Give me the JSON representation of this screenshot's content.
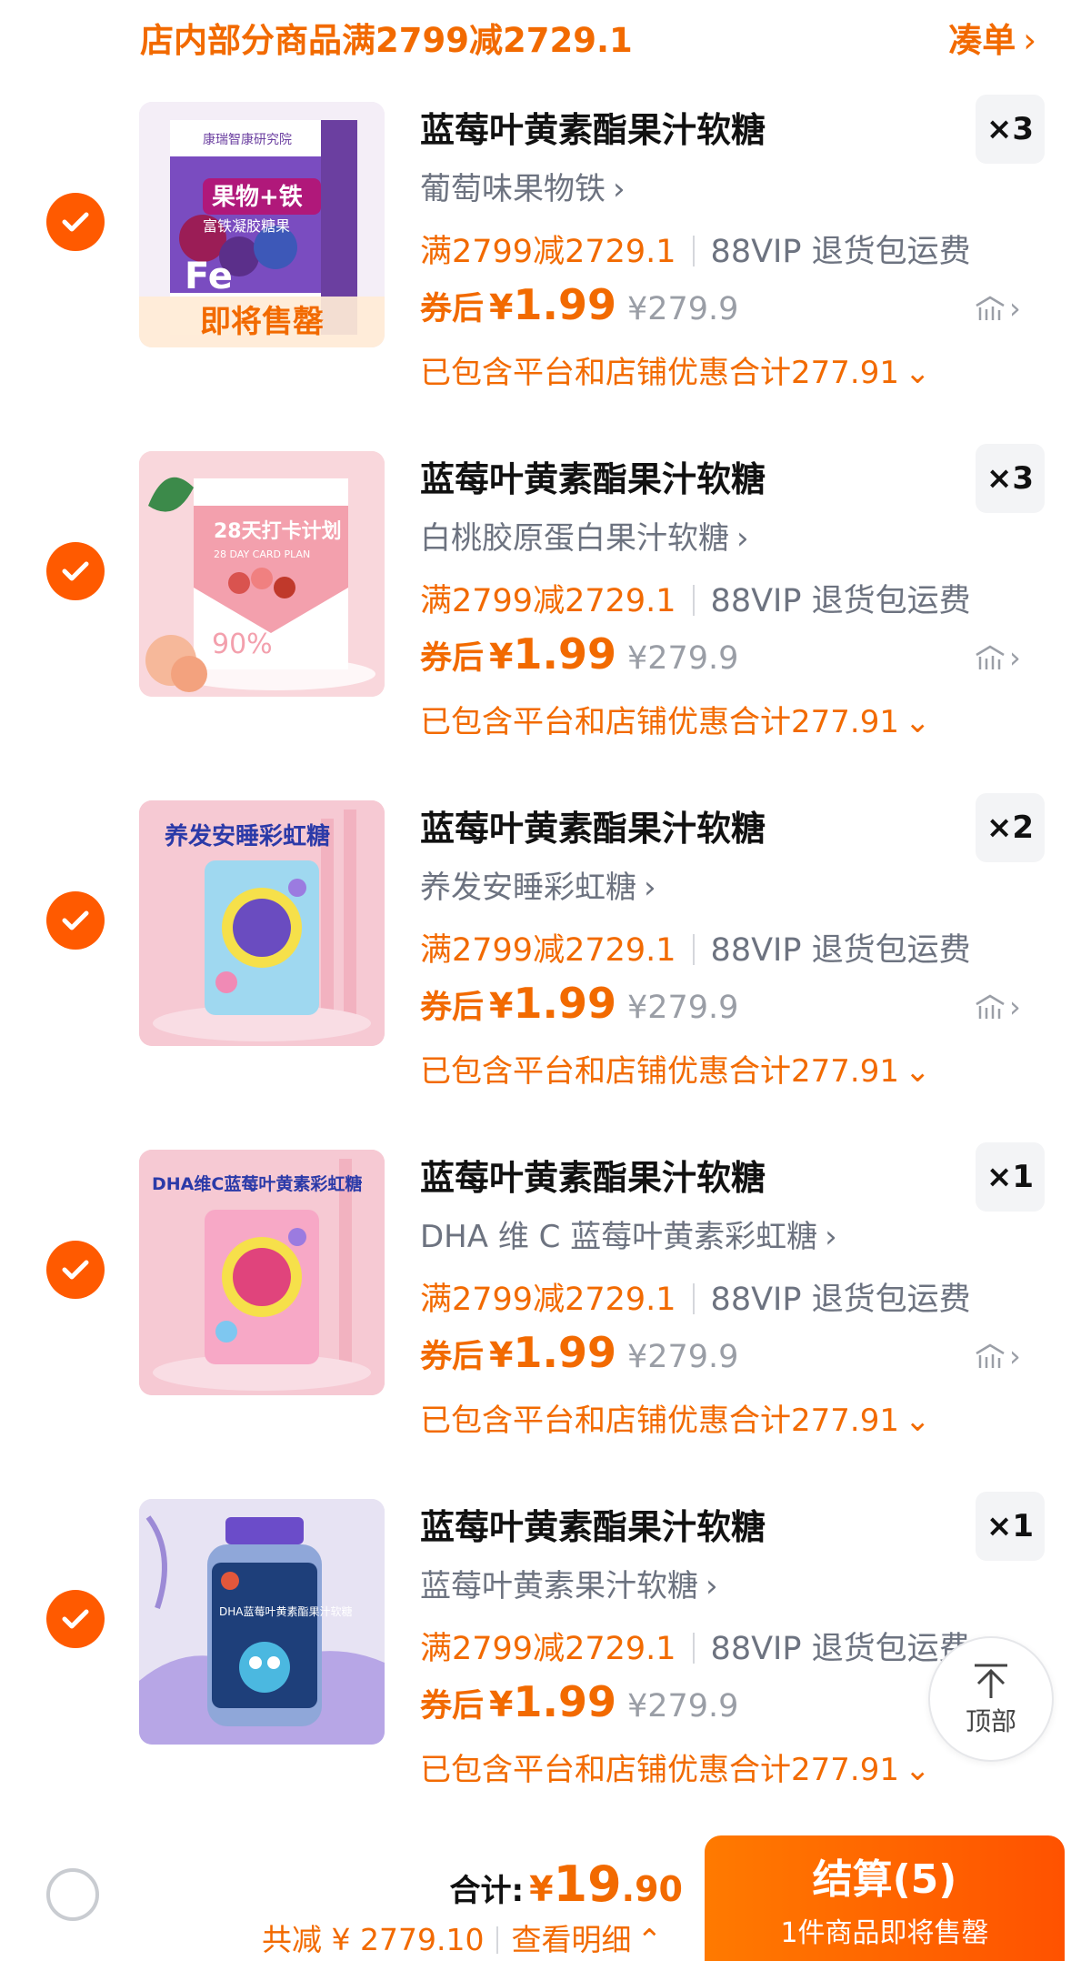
{
  "promo": {
    "text": "店内部分商品满2799减2729.1",
    "link_label": "凑单"
  },
  "items": [
    {
      "title": "蓝莓叶黄素酯果汁软糖",
      "quantity": "×3",
      "sku": "葡萄味果物铁",
      "deal": "满2799减2729.1",
      "vip": "88VIP 退货包运费",
      "coupon_label": "券后",
      "currency": "¥",
      "price": "1.99",
      "original_price": "¥279.9",
      "discount_note": "已包含平台和店铺优惠合计277.91",
      "tag": "即将售罄",
      "selected": true,
      "box_brand": "康瑞智康研究院",
      "box_title": "果物+铁",
      "box_sub": "富铁凝胶糖果"
    },
    {
      "title": "蓝莓叶黄素酯果汁软糖",
      "quantity": "×3",
      "sku": "白桃胶原蛋白果汁软糖",
      "deal": "满2799减2729.1",
      "vip": "88VIP 退货包运费",
      "coupon_label": "券后",
      "currency": "¥",
      "price": "1.99",
      "original_price": "¥279.9",
      "discount_note": "已包含平台和店铺优惠合计277.91",
      "selected": true,
      "box_title": "28天打卡计划",
      "box_sub": "28 DAY CARD PLAN",
      "box_num": "90%"
    },
    {
      "title": "蓝莓叶黄素酯果汁软糖",
      "quantity": "×2",
      "sku": "养发安睡彩虹糖",
      "deal": "满2799减2729.1",
      "vip": "88VIP 退货包运费",
      "coupon_label": "券后",
      "currency": "¥",
      "price": "1.99",
      "original_price": "¥279.9",
      "discount_note": "已包含平台和店铺优惠合计277.91",
      "selected": true,
      "banner": "养发安睡彩虹糖"
    },
    {
      "title": "蓝莓叶黄素酯果汁软糖",
      "quantity": "×1",
      "sku": "DHA 维 C 蓝莓叶黄素彩虹糖",
      "deal": "满2799减2729.1",
      "vip": "88VIP 退货包运费",
      "coupon_label": "券后",
      "currency": "¥",
      "price": "1.99",
      "original_price": "¥279.9",
      "discount_note": "已包含平台和店铺优惠合计277.91",
      "selected": true,
      "banner": "DHA维C蓝莓叶黄素彩虹糖"
    },
    {
      "title": "蓝莓叶黄素酯果汁软糖",
      "quantity": "×1",
      "sku": "蓝莓叶黄素果汁软糖",
      "deal": "满2799减2729.1",
      "vip": "88VIP 退货包运费",
      "coupon_label": "券后",
      "currency": "¥",
      "price": "1.99",
      "original_price": "¥279.9",
      "discount_note": "已包含平台和店铺优惠合计277.91",
      "selected": true,
      "jar_label": "DHA蓝莓叶黄素酯果汁软糖"
    }
  ],
  "back_to_top": "顶部",
  "footer": {
    "total_label": "合计:",
    "total_currency": "¥",
    "total_int": "19",
    "total_dec": ".90",
    "saving": "共减 ¥ 2779.10",
    "detail_label": "查看明细",
    "checkout_label": "结算(5)",
    "checkout_sub": "1件商品即将售罄"
  },
  "colors": {
    "accent": "#f26a00",
    "checkbox": "#ff5a00",
    "muted": "#6d7380"
  },
  "icons": {
    "check": "check-icon",
    "chevron": "chevron-right-icon",
    "trend": "price-trend-icon",
    "top": "arrow-up-icon"
  }
}
